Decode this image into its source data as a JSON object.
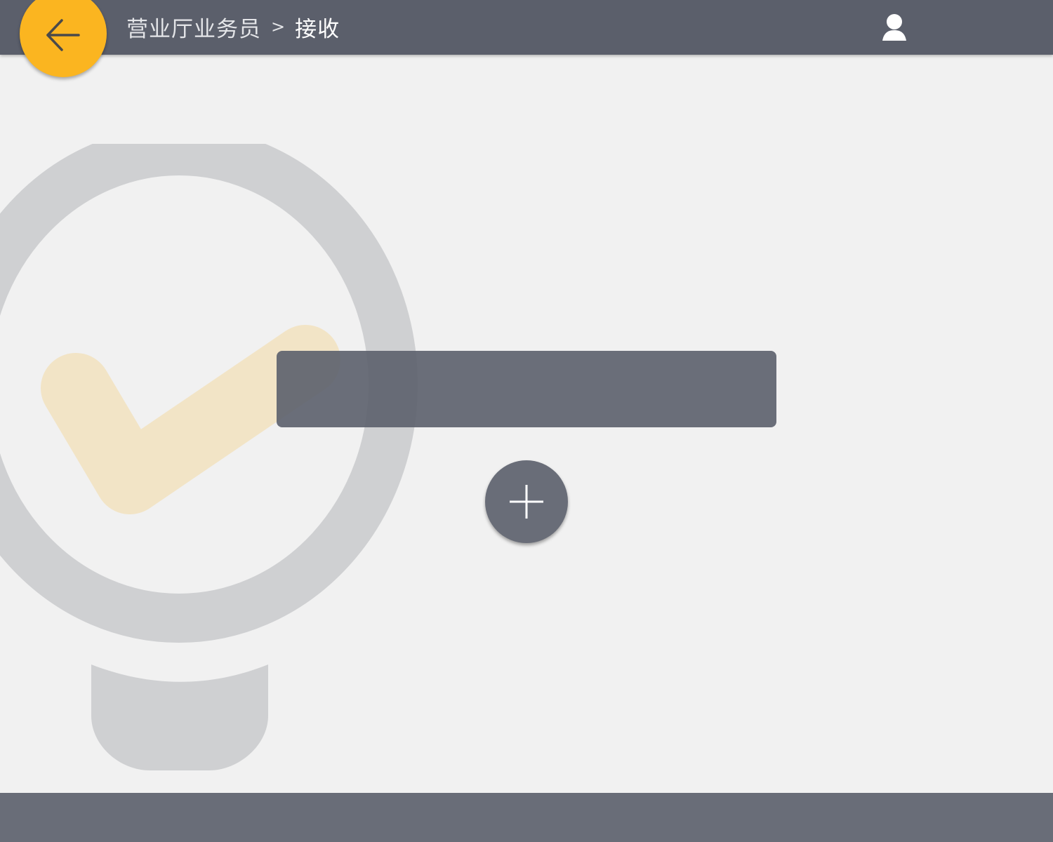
{
  "header": {
    "breadcrumb": {
      "parent": "营业厅业务员",
      "separator": ">",
      "current": "接收"
    },
    "back_icon": "arrow-left-icon",
    "user_icon": "user-icon"
  },
  "main": {
    "watermark_icon": "checkmark-badge-icon",
    "add_icon": "plus-icon"
  },
  "colors": {
    "header_bg": "#5b5f6b",
    "accent": "#fbb520",
    "page_bg": "#f1f1f1",
    "bar_bg": "#696d78"
  }
}
